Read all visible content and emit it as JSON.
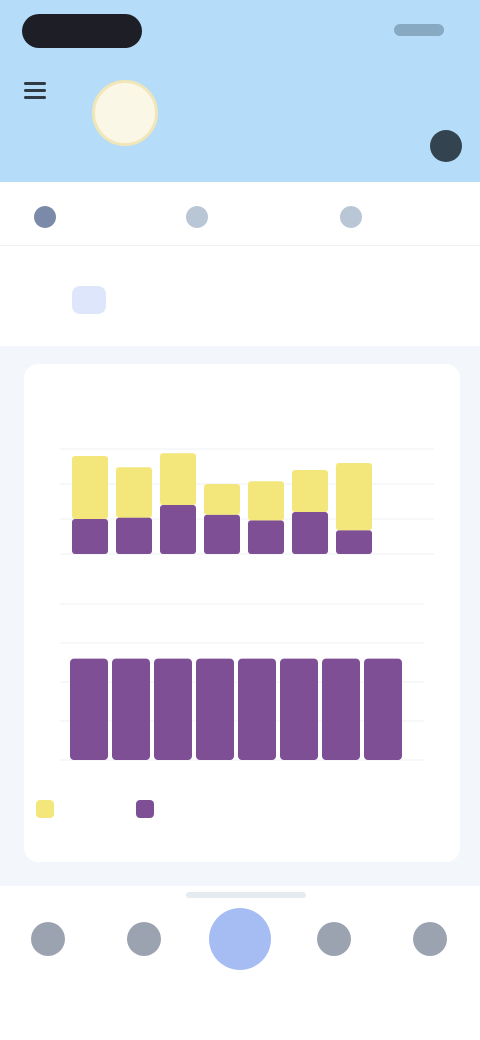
{
  "header": {
    "user_name": "",
    "user_subtitle": ""
  },
  "tabs": [
    {
      "label": ""
    },
    {
      "label": ""
    },
    {
      "label": ""
    }
  ],
  "summary": {
    "title": "",
    "subtitle": ""
  },
  "card": {
    "title": ""
  },
  "nav": [
    {
      "label": ""
    },
    {
      "label": ""
    },
    {
      "label": ""
    },
    {
      "label": ""
    },
    {
      "label": ""
    }
  ],
  "colors": {
    "header_bg": "#b5dcf9",
    "series_yellow": "#f3e77c",
    "series_purple": "#7e4f94",
    "nav_center": "#a6bdf4"
  },
  "chart_data": [
    {
      "type": "bar",
      "stacked": true,
      "categories": [
        "",
        "",
        "",
        "",
        "",
        "",
        ""
      ],
      "series": [
        {
          "values": [
            4.5,
            3.6,
            3.7,
            2.2,
            2.8,
            3.0,
            4.8
          ]
        },
        {
          "values": [
            2.5,
            2.6,
            3.5,
            2.8,
            2.4,
            3.0,
            1.7
          ]
        }
      ],
      "ylim": [
        0,
        10
      ],
      "grid": true
    },
    {
      "type": "bar",
      "categories": [
        "",
        "",
        "",
        "",
        "",
        "",
        "",
        ""
      ],
      "series": [
        {
          "values": [
            6.5,
            6.5,
            6.5,
            6.5,
            6.5,
            6.5,
            6.5,
            6.5
          ]
        }
      ],
      "ylim": [
        0,
        10
      ],
      "grid": true
    }
  ],
  "legend": {
    "items": [
      {
        "label": "",
        "color": "#f3e77c"
      },
      {
        "label": "",
        "color": "#7e4f94"
      }
    ],
    "placement": "bottom-left"
  }
}
